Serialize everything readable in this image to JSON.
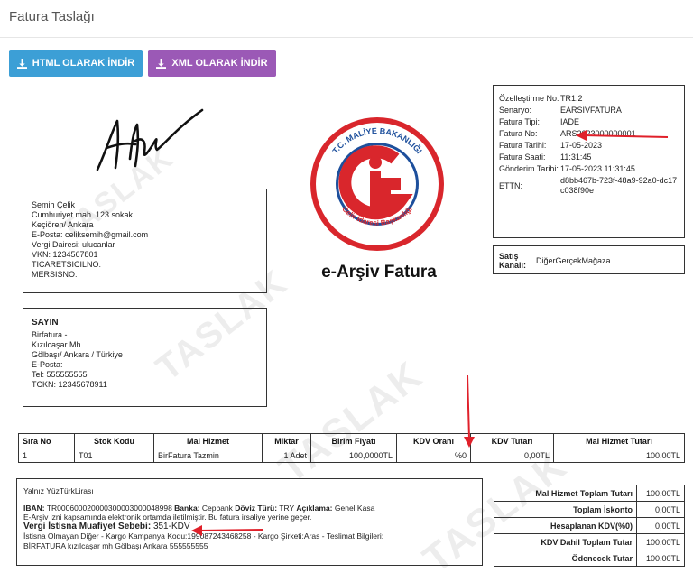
{
  "window": {
    "title": "Fatura Taslağı"
  },
  "toolbar": {
    "html_label": "HTML OLARAK İNDİR",
    "xml_label": "XML OLARAK İNDİR",
    "html_color": "#3c9fd6",
    "xml_color": "#9b59b6"
  },
  "watermark": "TASLAK",
  "sender": {
    "name": "Semih Çelik",
    "address1": "Cumhuriyet mah. 123 sokak",
    "address2": "Keçiören/ Ankara",
    "email": "E-Posta: celiksemih@gmail.com",
    "tax_office": "Vergi Dairesi: ulucanlar",
    "vkn": "VKN: 1234567801",
    "trade_reg": "TICARETSICILNO:",
    "mersis": "MERSISNO:"
  },
  "buyer": {
    "salutation": "SAYIN",
    "name": "Birfatura -",
    "address1": "Kızılcaşar Mh",
    "address2": "Gölbaşı/ Ankara / Türkiye",
    "email": "E-Posta:",
    "phone": "Tel: 555555555",
    "tckn": "TCKN: 12345678911"
  },
  "logo": {
    "top_text": "T.C. MALİYE BAKANLIĞI",
    "bottom_text": "Gelir İdaresi Başkanlığı",
    "red": "#d9262c",
    "blue": "#1d4f9c"
  },
  "doc_title": "e-Arşiv Fatura",
  "meta": {
    "rows": [
      {
        "label": "Özelleştirme No:",
        "value": "TR1.2"
      },
      {
        "label": "Senaryo:",
        "value": "EARSIVFATURA"
      },
      {
        "label": "Fatura Tipi:",
        "value": "IADE"
      },
      {
        "label": "Fatura No:",
        "value": "ARS2023000000001"
      },
      {
        "label": "Fatura Tarihi:",
        "value": "17-05-2023"
      },
      {
        "label": "Fatura Saati:",
        "value": "11:31:45"
      },
      {
        "label": "Gönderim Tarihi:",
        "value": "17-05-2023 11:31:45"
      },
      {
        "label": "ETTN:",
        "value": "d8bb467b-723f-48a9-92a0-dc17c038f90e"
      }
    ]
  },
  "channel": {
    "label": "Satış Kanalı:",
    "value": "DiğerGerçekMağaza"
  },
  "items": {
    "headers": [
      "Sıra No",
      "Stok Kodu",
      "Mal Hizmet",
      "Miktar",
      "Birim Fiyatı",
      "KDV Oranı",
      "KDV Tutarı",
      "Mal Hizmet Tutarı"
    ],
    "rows": [
      [
        "1",
        "T01",
        "BirFatura Tazmin",
        "1 Adet",
        "100,0000TL",
        "%0",
        "0,00TL",
        "100,00TL"
      ]
    ]
  },
  "notes": {
    "amount_words": "Yalnız YüzTürkLirası",
    "iban_label": "IBAN:",
    "iban": "TR000600020000300003000048998",
    "bank_label": "Banka:",
    "bank": "Cepbank",
    "currency_label": "Döviz Türü:",
    "currency": "TRY",
    "desc_label": "Açıklama:",
    "desc": "Genel Kasa",
    "einvoice_note": "E-Arşiv izni kapsamında elektronik ortamda iletilmiştir. Bu fatura irsaliye yerine geçer.",
    "exempt_label": "Vergi İstisna Muafiyet Sebebi:",
    "exempt_value": "351-KDV",
    "exempt_extra": "İstisna Olmayan Diğer - Kargo Kampanya Kodu:199087243468258 - Kargo Şirketi:Aras - Teslimat Bilgileri:",
    "delivery": "BİRFATURA kızılcaşar mh Gölbaşı Ankara 555555555"
  },
  "totals": [
    {
      "label": "Mal Hizmet Toplam Tutarı",
      "value": "100,00TL"
    },
    {
      "label": "Toplam İskonto",
      "value": "0,00TL"
    },
    {
      "label": "Hesaplanan KDV(%0)",
      "value": "0,00TL"
    },
    {
      "label": "KDV Dahil Toplam Tutar",
      "value": "100,00TL"
    },
    {
      "label": "Ödenecek Tutar",
      "value": "100,00TL"
    }
  ],
  "annotation_color": "#e0202a"
}
